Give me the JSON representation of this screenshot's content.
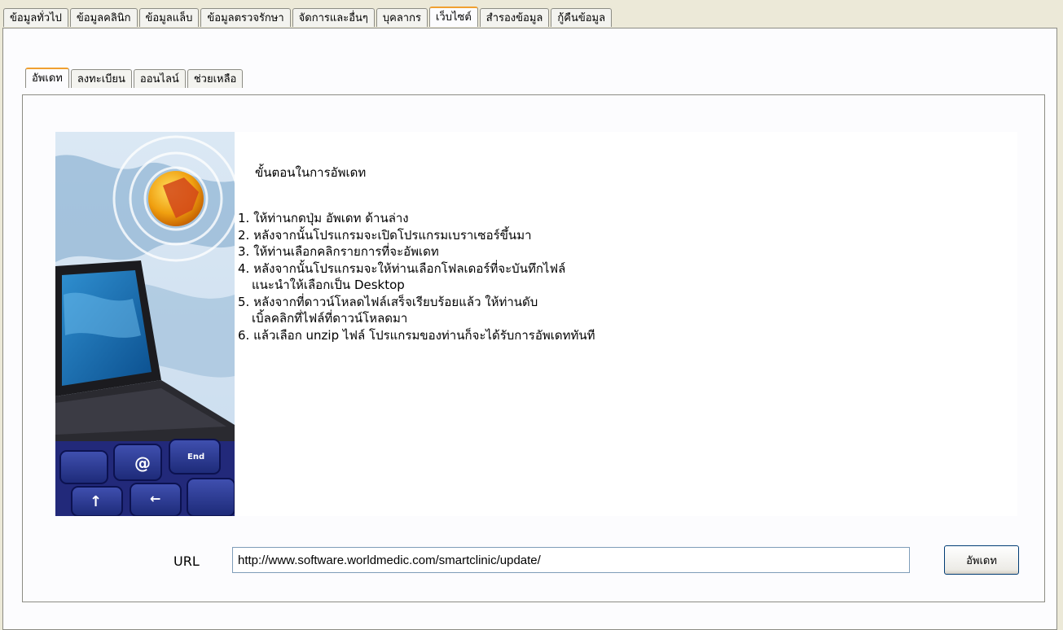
{
  "main_tabs": [
    "ข้อมูลทั่วไป",
    "ข้อมูลคลินิก",
    "ข้อมูลแล็บ",
    "ข้อมูลตรวจรักษา",
    "จัดการและอื่นๆ",
    "บุคลากร",
    "เว็บไซต์",
    "สำรองข้อมูล",
    "กู้คืนข้อมูล"
  ],
  "active_main_tab": "เว็บไซต์",
  "sub_tabs": [
    "อัพเดท",
    "ลงทะเบียน",
    "ออนไลน์",
    "ช่วยเหลือ"
  ],
  "active_sub_tab": "อัพเดท",
  "update_panel": {
    "heading": "ขั้นตอนในการอัพเดท",
    "steps": [
      {
        "line1": "1. ให้ท่านกดปุ่ม อัพเดท ด้านล่าง",
        "line2": ""
      },
      {
        "line1": "2. หลังจากนั้นโปรแกรมจะเปิดโปรแกรมเบราเซอร์ขึ้นมา",
        "line2": ""
      },
      {
        "line1": "3. ให้ท่านเลือกคลิกรายการที่จะอัพเดท",
        "line2": ""
      },
      {
        "line1": "4. หลังจากนั้นโปรแกรมจะให้ท่านเลือกโฟลเดอร์ที่จะบันทึกไฟล์",
        "line2": "แนะนำให้เลือกเป็น Desktop"
      },
      {
        "line1": "5. หลังจากที่ดาวน์โหลดไฟล์เสร็จเรียบร้อยแล้ว ให้ท่านดับ",
        "line2": "เบิ้ลคลิกที่ไฟล์ที่ดาวน์โหลดมา"
      },
      {
        "line1": "6. แล้วเลือก unzip ไฟล์ โปรแกรมของท่านก็จะได้รับการอัพเดททันที",
        "line2": ""
      }
    ],
    "url_label": "URL",
    "url_value": "http://www.software.worldmedic.com/smartclinic/update/",
    "update_button_label": "อัพเดท"
  },
  "colors": {
    "window_bg": "#ece9d8",
    "panel_bg": "#fcfcfe",
    "active_tab_accent": "#f0a030",
    "border": "#8c8c84"
  }
}
